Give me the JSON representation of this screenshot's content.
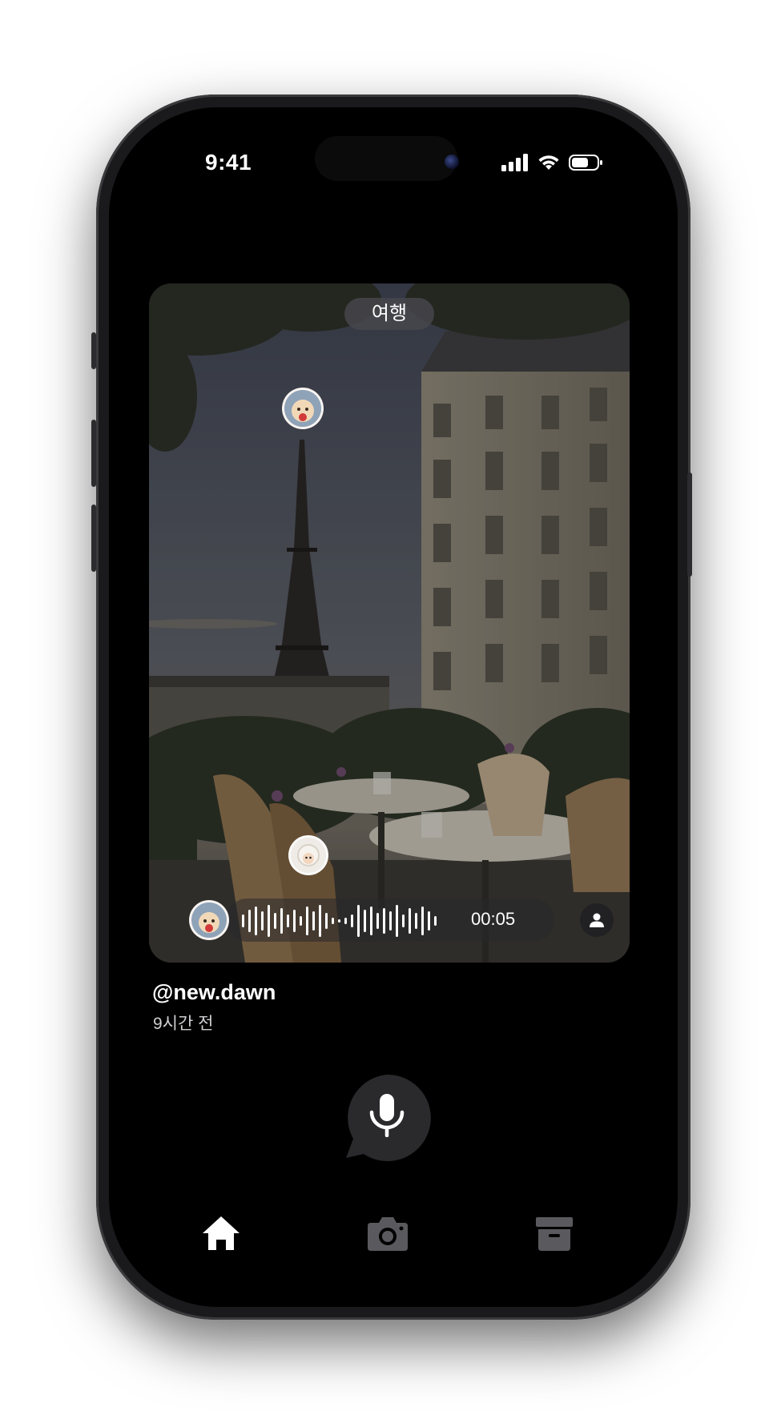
{
  "status_bar": {
    "time": "9:41"
  },
  "post": {
    "category_tag": "여행",
    "username": "@new.dawn",
    "time_ago": "9시간 전"
  },
  "voice_message": {
    "duration": "00:05"
  },
  "icons": {
    "signal": "signal-icon",
    "wifi": "wifi-icon",
    "battery": "battery-icon",
    "mic": "mic-icon",
    "profile": "person-icon",
    "home": "home-icon",
    "camera": "camera-icon",
    "archive": "archive-icon"
  },
  "tabs": {
    "active": "home"
  },
  "colors": {
    "background": "#000000",
    "text_primary": "#ffffff",
    "text_secondary": "#cfcfd2",
    "tab_active": "#ffffff",
    "tab_inactive": "#5a5a5e",
    "mic_button": "#2a2a2c"
  }
}
